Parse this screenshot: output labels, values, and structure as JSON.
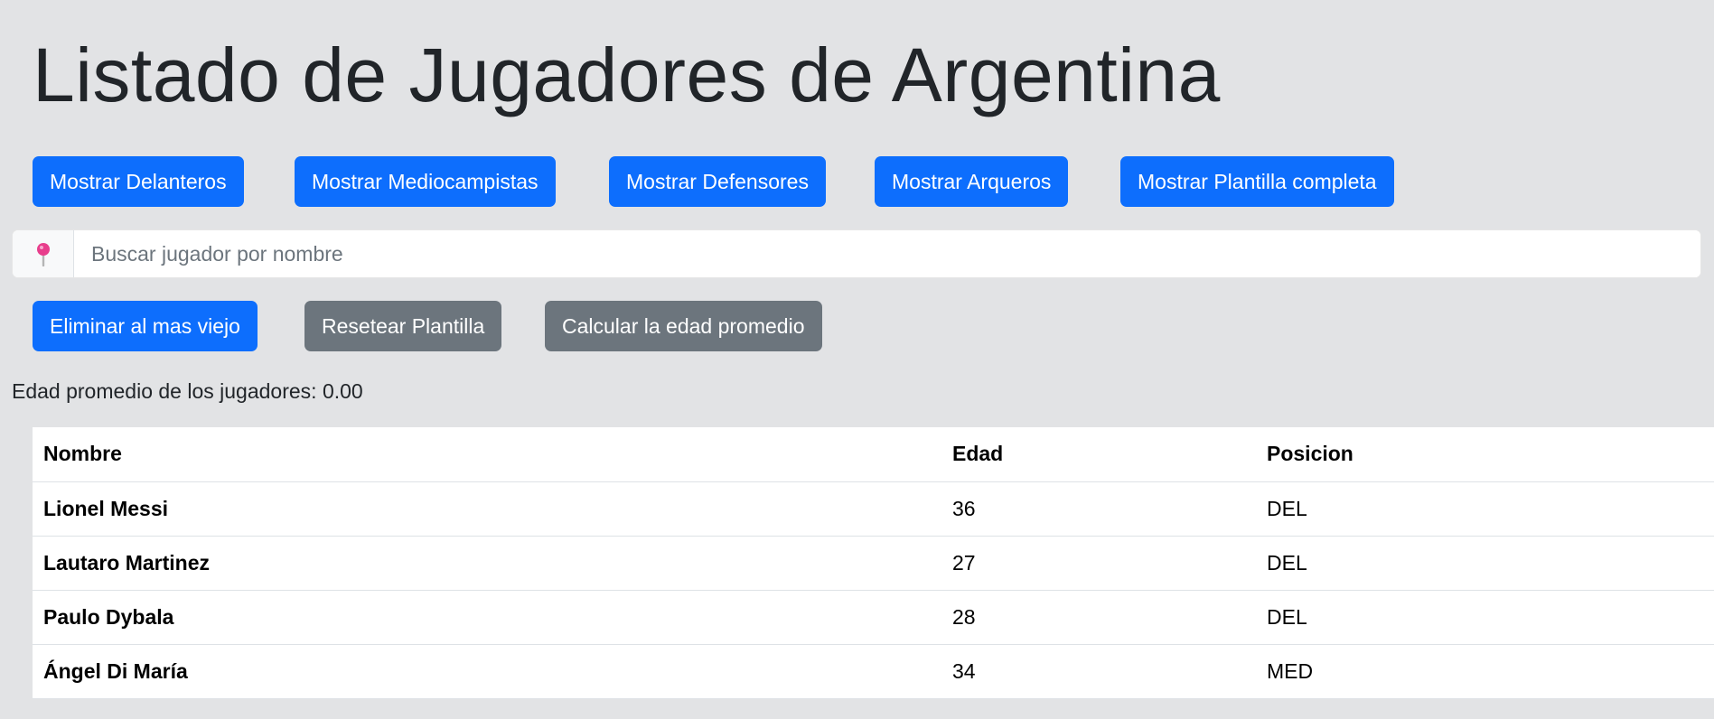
{
  "page": {
    "title": "Listado de Jugadores de Argentina"
  },
  "filters": {
    "delanteros": "Mostrar Delanteros",
    "mediocampistas": "Mostrar Mediocampistas",
    "defensores": "Mostrar Defensores",
    "arqueros": "Mostrar Arqueros",
    "plantilla": "Mostrar Plantilla completa"
  },
  "search": {
    "icon": "pushpin-icon",
    "placeholder": "Buscar jugador por nombre",
    "value": ""
  },
  "actions": {
    "eliminar": "Eliminar al mas viejo",
    "resetear": "Resetear Plantilla",
    "calcular": "Calcular la edad promedio"
  },
  "average": {
    "text": "Edad promedio de los jugadores: 0.00"
  },
  "table": {
    "headers": {
      "name": "Nombre",
      "age": "Edad",
      "position": "Posicion"
    },
    "rows": [
      {
        "name": "Lionel Messi",
        "age": "36",
        "position": "DEL"
      },
      {
        "name": "Lautaro Martinez",
        "age": "27",
        "position": "DEL"
      },
      {
        "name": "Paulo Dybala",
        "age": "28",
        "position": "DEL"
      },
      {
        "name": "Ángel Di María",
        "age": "34",
        "position": "MED"
      }
    ]
  },
  "colors": {
    "primary": "#0d6efd",
    "secondary": "#6c757d",
    "background": "#e2e3e5",
    "pin": "#e83e8c"
  }
}
